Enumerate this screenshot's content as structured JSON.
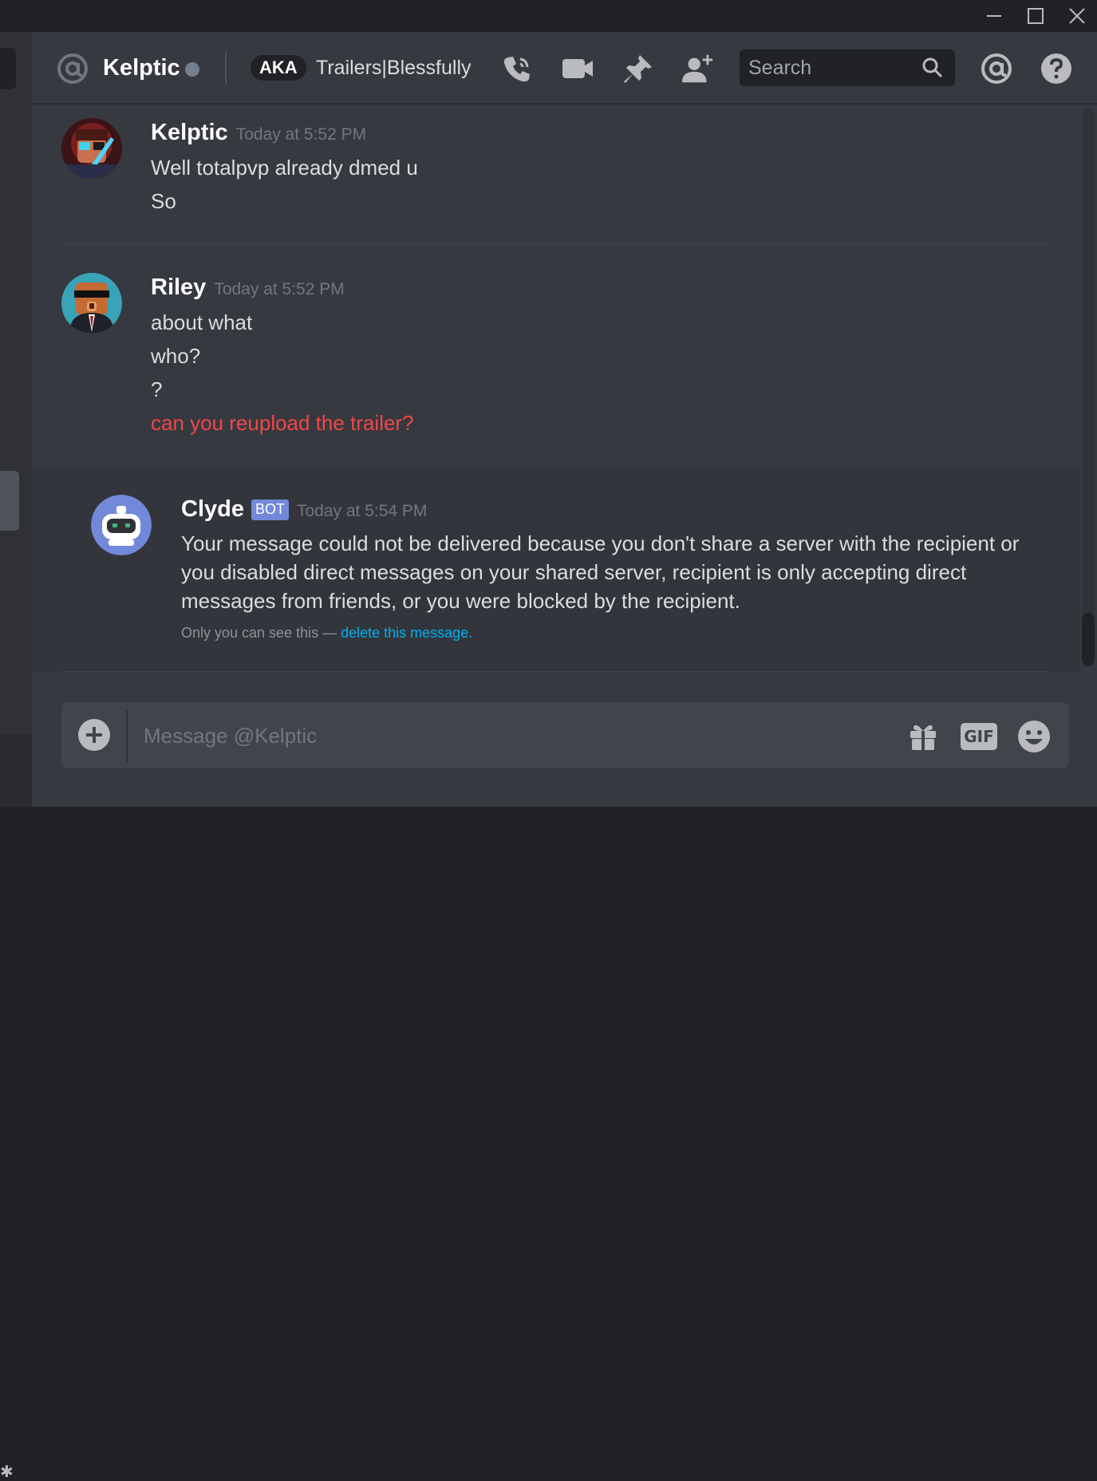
{
  "window": {
    "controls": [
      "minimize-icon",
      "maximize-icon",
      "close-icon"
    ]
  },
  "header": {
    "channel_name": "Kelptic",
    "status": "offline",
    "aka_label": "AKA",
    "aka_names": "Trailers|Blessfully",
    "icons": [
      "voice-call-icon",
      "video-call-icon",
      "pin-icon",
      "add-friend-icon",
      "mentions-icon",
      "help-icon"
    ],
    "search_placeholder": "Search"
  },
  "messages": [
    {
      "author": "Kelptic",
      "timestamp": "Today at 5:52 PM",
      "lines": [
        "Well totalpvp already dmed u",
        "So"
      ]
    },
    {
      "author": "Riley",
      "timestamp": "Today at 5:52 PM",
      "lines": [
        "about what",
        "who?",
        "?"
      ],
      "failed_line": "can you reupload the trailer?"
    },
    {
      "author": "Clyde",
      "badge": "BOT",
      "timestamp": "Today at 5:54 PM",
      "text": "Your message could not be delivered because you don't share a server with the recipient or you disabled direct messages on your shared server, recipient is only accepting direct messages from friends, or you were blocked by the recipient.",
      "ephemeral_note": "Only you can see this —",
      "delete_link": "delete this message."
    }
  ],
  "composer": {
    "placeholder": "Message @Kelptic",
    "gif_label": "GIF",
    "icons": [
      "add-attachment-icon",
      "gift-icon",
      "gif-icon",
      "emoji-icon"
    ]
  },
  "colors": {
    "background": "#36393f",
    "sidebar": "#2f3136",
    "accent": "#7289da",
    "failed_text": "#f04747",
    "link": "#00b0f4"
  }
}
